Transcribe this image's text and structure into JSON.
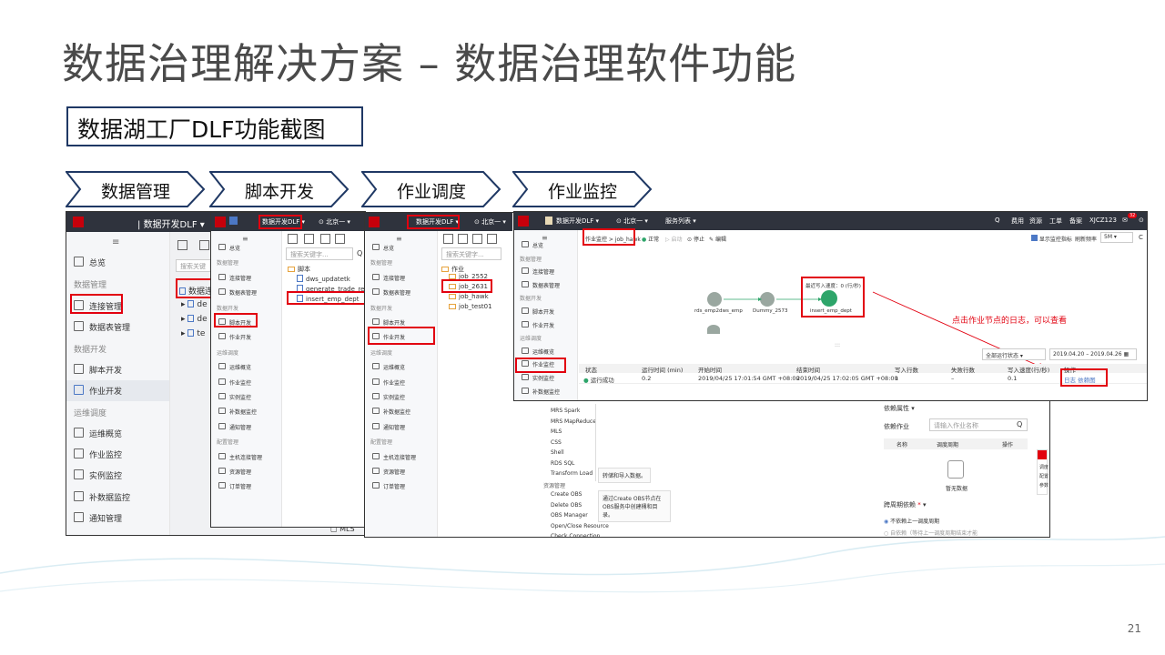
{
  "title": "数据治理解决方案 – 数据治理软件功能",
  "subtitle": "数据湖工厂DLF功能截图",
  "steps": [
    "数据管理",
    "脚本开发",
    "作业调度",
    "作业监控"
  ],
  "page_number": "21",
  "panel1": {
    "app_title": "数据开发DLF",
    "nav": [
      {
        "label": "总览",
        "group": false
      },
      {
        "label": "数据管理",
        "group": true
      },
      {
        "label": "连接管理",
        "group": false
      },
      {
        "label": "数据表管理",
        "group": false
      },
      {
        "label": "数据开发",
        "group": true
      },
      {
        "label": "脚本开发",
        "group": false
      },
      {
        "label": "作业开发",
        "group": false
      },
      {
        "label": "运维调度",
        "group": true
      },
      {
        "label": "运维概览",
        "group": false
      },
      {
        "label": "作业监控",
        "group": false
      },
      {
        "label": "实例监控",
        "group": false
      },
      {
        "label": "补数据监控",
        "group": false
      },
      {
        "label": "通知管理",
        "group": false
      }
    ],
    "search_placeholder": "搜索关键",
    "tree": [
      "数据连",
      "de",
      "de",
      "te"
    ],
    "bottom_item": "MLS"
  },
  "panel2": {
    "app_title": "数据开发DLF",
    "region": "北京一",
    "search_placeholder": "搜索关键字...",
    "nav": [
      {
        "label": "总览",
        "group": false
      },
      {
        "label": "数据管理",
        "group": true
      },
      {
        "label": "连接管理",
        "group": false
      },
      {
        "label": "数据表管理",
        "group": false
      },
      {
        "label": "数据开发",
        "group": true
      },
      {
        "label": "脚本开发",
        "group": false
      },
      {
        "label": "作业开发",
        "group": false
      },
      {
        "label": "运维调度",
        "group": true
      },
      {
        "label": "运维概览",
        "group": false
      },
      {
        "label": "作业监控",
        "group": false
      },
      {
        "label": "实例监控",
        "group": false
      },
      {
        "label": "补数据监控",
        "group": false
      },
      {
        "label": "通知管理",
        "group": false
      },
      {
        "label": "配置管理",
        "group": true
      },
      {
        "label": "主机连接管理",
        "group": false
      },
      {
        "label": "资源管理",
        "group": false
      },
      {
        "label": "订单管理",
        "group": false
      }
    ],
    "tree_root": "脚本",
    "tree": [
      "dws_updatetk",
      "generate_trade_report",
      "insert_emp_dept"
    ]
  },
  "panel3": {
    "app_title": "数据开发DLF",
    "region": "北京一",
    "search_placeholder": "搜索关键字...",
    "nav": [
      {
        "label": "总览",
        "group": false
      },
      {
        "label": "数据管理",
        "group": true
      },
      {
        "label": "连接管理",
        "group": false
      },
      {
        "label": "数据表管理",
        "group": false
      },
      {
        "label": "数据开发",
        "group": true
      },
      {
        "label": "脚本开发",
        "group": false
      },
      {
        "label": "作业开发",
        "group": false
      },
      {
        "label": "运维调度",
        "group": true
      },
      {
        "label": "运维概览",
        "group": false
      },
      {
        "label": "作业监控",
        "group": false
      },
      {
        "label": "实例监控",
        "group": false
      },
      {
        "label": "补数据监控",
        "group": false
      },
      {
        "label": "通知管理",
        "group": false
      },
      {
        "label": "配置管理",
        "group": true
      },
      {
        "label": "主机连接管理",
        "group": false
      },
      {
        "label": "资源管理",
        "group": false
      },
      {
        "label": "订单管理",
        "group": false
      }
    ],
    "tree_root": "作业",
    "tree": [
      "job_2552",
      "job_2631",
      "job_hawk",
      "job_test01"
    ],
    "node_list": [
      "MRS Spark",
      "MRS MapReduce",
      "MLS",
      "CSS",
      "Shell",
      "RDS SQL",
      "Transform Load",
      "资源管理",
      "Create OBS",
      "Delete OBS",
      "OBS Manager",
      "Open/Close Resource",
      "Check Connection"
    ],
    "tooltip1": "转储和导入数据。",
    "tooltip2": "通过Create OBS节点在OBS服务中创建桶和目录。",
    "dep_title": "依赖属性",
    "dep_job_label": "依赖作业",
    "dep_job_placeholder": "请输入作业名称",
    "dep_cols": [
      "名称",
      "调度周期",
      "操作"
    ],
    "empty_text": "暂无数据",
    "cross_title": "跨周期依赖",
    "radio1": "不依赖上一调度周期",
    "radio2": "自依赖（等待上一调度周期结束才能",
    "side_tabs": [
      "调度",
      "配置",
      "参数"
    ]
  },
  "panel4": {
    "app_title": "数据开发DLF",
    "region": "北京一",
    "service_list": "服务列表",
    "top_links": [
      "费用",
      "资源",
      "工单",
      "备案",
      "XJCZ123"
    ],
    "badge": "32",
    "breadcrumb": "作业监控 > job_hawk",
    "toolbar": [
      "正常",
      "启动",
      "停止",
      "编辑"
    ],
    "show_monitor": "显示监控指标",
    "refresh_label": "刷新频率",
    "refresh_value": "5M",
    "nav": [
      {
        "label": "总览",
        "group": false
      },
      {
        "label": "数据管理",
        "group": true
      },
      {
        "label": "连接管理",
        "group": false
      },
      {
        "label": "数据表管理",
        "group": false
      },
      {
        "label": "数据开发",
        "group": true
      },
      {
        "label": "脚本开发",
        "group": false
      },
      {
        "label": "作业开发",
        "group": false
      },
      {
        "label": "运维调度",
        "group": true
      },
      {
        "label": "运维概览",
        "group": false
      },
      {
        "label": "作业监控",
        "group": false
      },
      {
        "label": "实例监控",
        "group": false
      },
      {
        "label": "补数据监控",
        "group": false
      }
    ],
    "nodes": [
      "rds_emp2dws_emp",
      "Dummy_2573",
      "insert_emp_dept"
    ],
    "node_stat": "最近写入速度：0 (行/秒)",
    "status_filter": "全部运行状态",
    "date_range": "2019.04.20 – 2019.04.26",
    "columns": [
      "状态",
      "运行时间 (min)",
      "开始时间",
      "结束时间",
      "写入行数",
      "失败行数",
      "写入速度(行/秒)",
      "操作"
    ],
    "row": {
      "status": "运行成功",
      "duration": "0.2",
      "start": "2019/04/25 17:01:54 GMT +08:00",
      "end": "2019/04/25 17:02:05 GMT +08:00",
      "write_rows": "1",
      "fail_rows": "–",
      "speed": "0.1",
      "actions": "日志  依赖图"
    },
    "annotation": "点击作业节点的日志，可以查看"
  },
  "colors": {
    "accent_red": "#e2000f",
    "topbar": "#2f333d",
    "title_gray": "#4a4a4a",
    "box_border": "#1f3864"
  }
}
